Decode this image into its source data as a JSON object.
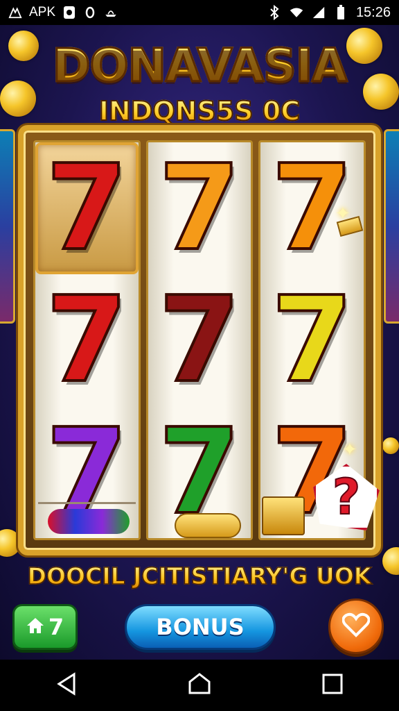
{
  "status_bar": {
    "apk_label": "APK",
    "time": "15:26",
    "icons": [
      "apk-logo-icon",
      "notification-o-icon",
      "alarm-icon",
      "boat-icon",
      "bluetooth-icon",
      "wifi-icon",
      "signal-icon",
      "battery-icon"
    ]
  },
  "game": {
    "title": "DONAVASIA",
    "subtitle": "INDQNS5S 0C",
    "tagline": "DOOCIL JCITISTIARY'G UOK",
    "reels": [
      [
        {
          "symbol": "7",
          "color": "#d81818"
        },
        {
          "symbol": "7",
          "color": "#d81818"
        },
        {
          "symbol": "7",
          "color": "#8a2ad8"
        }
      ],
      [
        {
          "symbol": "7",
          "color": "#f59a18"
        },
        {
          "symbol": "7",
          "color": "#8a1414"
        },
        {
          "symbol": "7",
          "color": "#1fa02a"
        }
      ],
      [
        {
          "symbol": "7",
          "color": "#f5900a"
        },
        {
          "symbol": "7",
          "color": "#e8d81a"
        },
        {
          "symbol": "7",
          "color": "#f2680a"
        }
      ]
    ],
    "question_mark": "?",
    "buttons": {
      "home_count": "7",
      "bonus_label": "BONUS"
    }
  },
  "nav": {
    "icons": [
      "back-icon",
      "home-icon",
      "recents-icon"
    ]
  }
}
